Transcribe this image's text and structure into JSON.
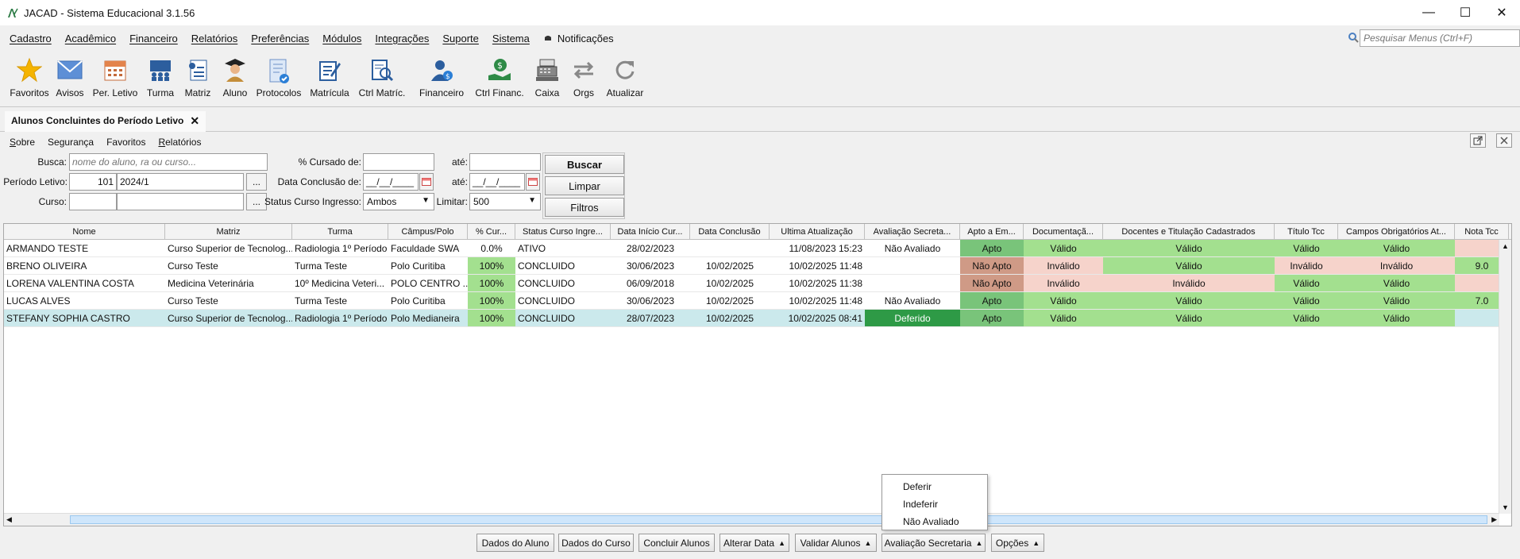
{
  "window": {
    "title": "JACAD - Sistema Educacional 3.1.56"
  },
  "menu": {
    "items": [
      "Cadastro",
      "Acadêmico",
      "Financeiro",
      "Relatórios",
      "Preferências",
      "Módulos",
      "Integrações",
      "Suporte",
      "Sistema",
      "Notificações"
    ],
    "search_placeholder": "Pesquisar Menus (Ctrl+F)"
  },
  "toolbar": {
    "buttons": [
      {
        "label": "Favoritos",
        "icon": "star-icon"
      },
      {
        "label": "Avisos",
        "icon": "envelope-icon"
      },
      {
        "label": "Per. Letivo",
        "icon": "calendar-icon"
      },
      {
        "label": "Turma",
        "icon": "class-icon"
      },
      {
        "label": "Matriz",
        "icon": "matrix-icon"
      },
      {
        "label": "Aluno",
        "icon": "student-icon"
      },
      {
        "label": "Protocolos",
        "icon": "protocol-icon"
      },
      {
        "label": "Matrícula",
        "icon": "enrollment-icon"
      },
      {
        "label": "Ctrl Matríc.",
        "icon": "enrollment-control-icon"
      },
      {
        "label": "Financeiro",
        "icon": "finance-icon"
      },
      {
        "label": "Ctrl Financ.",
        "icon": "finance-control-icon"
      },
      {
        "label": "Caixa",
        "icon": "cash-register-icon"
      },
      {
        "label": "Orgs",
        "icon": "orgs-icon"
      },
      {
        "label": "Atualizar",
        "icon": "refresh-icon"
      }
    ]
  },
  "tab": {
    "title": "Alunos Concluintes do Período Letivo"
  },
  "submenu": [
    "Sobre",
    "Segurança",
    "Favoritos",
    "Relatórios"
  ],
  "filters": {
    "busca_label": "Busca:",
    "busca_placeholder": "nome do aluno, ra ou curso...",
    "periodo_label": "Período Letivo:",
    "periodo_code": "101",
    "periodo_value": "2024/1",
    "curso_label": "Curso:",
    "cursado_label": "% Cursado de:",
    "ate_label": "até:",
    "data_conclusao_label": "Data Conclusão de:",
    "date_mask": "__/__/____",
    "status_label": "Status Curso Ingresso:",
    "status_value": "Ambos",
    "limitar_label": "Limitar:",
    "limitar_value": "500",
    "ellipsis": "..."
  },
  "actions": {
    "buscar": "Buscar",
    "limpar": "Limpar",
    "filtros": "Filtros"
  },
  "grid": {
    "columns": [
      "Nome",
      "Matriz",
      "Turma",
      "Câmpus/Polo",
      "% Cur...",
      "Status Curso Ingre...",
      "Data Início Cur...",
      "Data Conclusão",
      "Ultima Atualização",
      "Avaliação Secreta...",
      "Apto a Em...",
      "Documentaçã...",
      "Docentes e Titulação Cadastrados",
      "Título Tcc",
      "Campos Obrigatórios At...",
      "Nota Tcc"
    ],
    "rows": [
      [
        "ARMANDO TESTE",
        "Curso Superior de Tecnolog...",
        "Radiologia 1º Período",
        "Faculdade SWA",
        "0.0%",
        "ATIVO",
        "28/02/2023",
        "",
        "11/08/2023 15:23",
        "Não Avaliado",
        "Apto",
        "Válido",
        "Válido",
        "Válido",
        "Válido",
        ""
      ],
      [
        "BRENO OLIVEIRA",
        "Curso Teste",
        "Turma Teste",
        "Polo Curitiba",
        "100%",
        "CONCLUIDO",
        "30/06/2023",
        "10/02/2025",
        "10/02/2025 11:48",
        "",
        "Não Apto",
        "Inválido",
        "Válido",
        "Inválido",
        "Inválido",
        "9.0"
      ],
      [
        "LORENA VALENTINA COSTA",
        "Medicina Veterinária",
        "10º  Medicina Veteri...",
        "POLO CENTRO ...",
        "100%",
        "CONCLUIDO",
        "06/09/2018",
        "10/02/2025",
        "10/02/2025 11:38",
        "",
        "Não Apto",
        "Inválido",
        "Inválido",
        "Válido",
        "Válido",
        ""
      ],
      [
        "LUCAS ALVES",
        "Curso Teste",
        "Turma Teste",
        "Polo Curitiba",
        "100%",
        "CONCLUIDO",
        "30/06/2023",
        "10/02/2025",
        "10/02/2025 11:48",
        "Não Avaliado",
        "Apto",
        "Válido",
        "Válido",
        "Válido",
        "Válido",
        "7.0"
      ],
      [
        "STEFANY SOPHIA CASTRO",
        "Curso Superior de Tecnolog...",
        "Radiologia 1º Período",
        "Polo Medianeira",
        "100%",
        "CONCLUIDO",
        "28/07/2023",
        "10/02/2025",
        "10/02/2025 08:41",
        "Deferido",
        "Apto",
        "Válido",
        "Válido",
        "Válido",
        "Válido",
        ""
      ]
    ],
    "selected_row": 4
  },
  "bottom_buttons": [
    "Dados do Aluno",
    "Dados do Curso",
    "Concluir Alunos",
    "Alterar Data",
    "Validar Alunos",
    "Avaliação Secretaria",
    "Opções"
  ],
  "popup": {
    "items": [
      "Deferir",
      "Indeferir",
      "Não Avaliado"
    ]
  },
  "colors": {
    "valid": "#a3e08f",
    "apto": "#79c47a",
    "invalid": "#f6d3cb",
    "nao_apto": "#cf9a86",
    "deferido": "#2e9a46",
    "selected_row": "#cbe9ec"
  }
}
